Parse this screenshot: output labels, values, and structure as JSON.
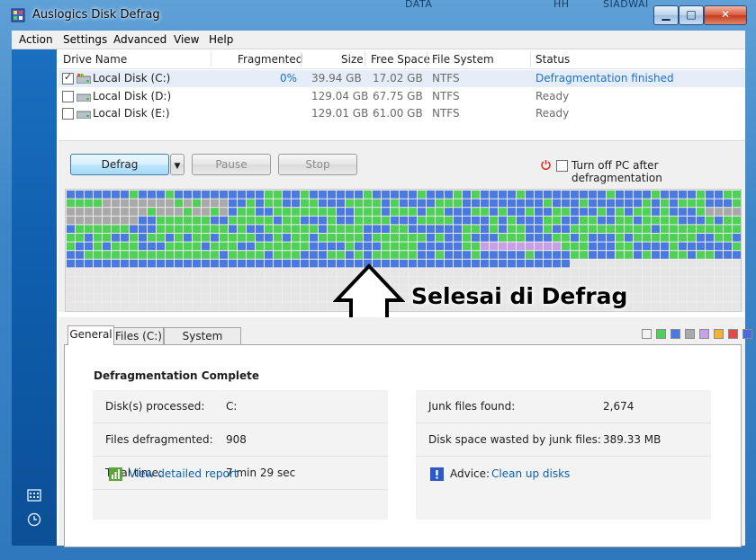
{
  "window": {
    "title": "Auslogics Disk Defrag",
    "controls": {
      "minimize": "▁",
      "maximize": "□",
      "close": "✕"
    },
    "bg_snippets": [
      "DATA",
      "HH",
      "SIADWAI"
    ]
  },
  "menu": [
    "Action",
    "Settings",
    "Advanced",
    "View",
    "Help"
  ],
  "drive_table": {
    "columns": [
      "Drive Name",
      "Fragmented",
      "Size",
      "Free Space",
      "File System",
      "Status"
    ],
    "rows": [
      {
        "checked": true,
        "name": "Local Disk (C:)",
        "fragmented": "0%",
        "size": "39.94 GB",
        "free": "17.02 GB",
        "fs": "NTFS",
        "status": "Defragmentation finished",
        "selected": true
      },
      {
        "checked": false,
        "name": "Local Disk (D:)",
        "fragmented": "",
        "size": "129.04 GB",
        "free": "67.75 GB",
        "fs": "NTFS",
        "status": "Ready",
        "selected": false
      },
      {
        "checked": false,
        "name": "Local Disk (E:)",
        "fragmented": "",
        "size": "129.01 GB",
        "free": "61.00 GB",
        "fs": "NTFS",
        "status": "Ready",
        "selected": false
      }
    ]
  },
  "toolbar": {
    "defrag_label": "Defrag",
    "pause_label": "Pause",
    "stop_label": "Stop",
    "turn_off_label": "Turn off PC after defragmentation"
  },
  "annotation": {
    "text": "Selesai di Defrag"
  },
  "tabs": [
    "General",
    "Files (C:)",
    "System Health"
  ],
  "legend_colors": [
    "#f2f2f2",
    "#4fd056",
    "#4a79e0",
    "#a9a9a9",
    "#c8a0e6",
    "#f2b234",
    "#e34848",
    "#4a6be0"
  ],
  "general": {
    "title": "Defragmentation Complete",
    "left": [
      {
        "label": "Disk(s) processed:",
        "value": "C:"
      },
      {
        "label": "Files defragmented:",
        "value": "908"
      },
      {
        "label": "Total time:",
        "value": "7 min 29 sec"
      }
    ],
    "right": [
      {
        "label": "Junk files found:",
        "value": "2,674"
      },
      {
        "label": "Disk space wasted by junk files:",
        "value": "389.33 MB"
      }
    ],
    "report_link": "View detailed report",
    "advice_label": "Advice:",
    "advice_link": "Clean up disks"
  },
  "colors": {
    "fragmented_free": "#e6e6e6",
    "defragmented": "#4fd056",
    "used": "#4a79e0",
    "system": "#a9a9a9",
    "mft": "#c8a0e6"
  }
}
